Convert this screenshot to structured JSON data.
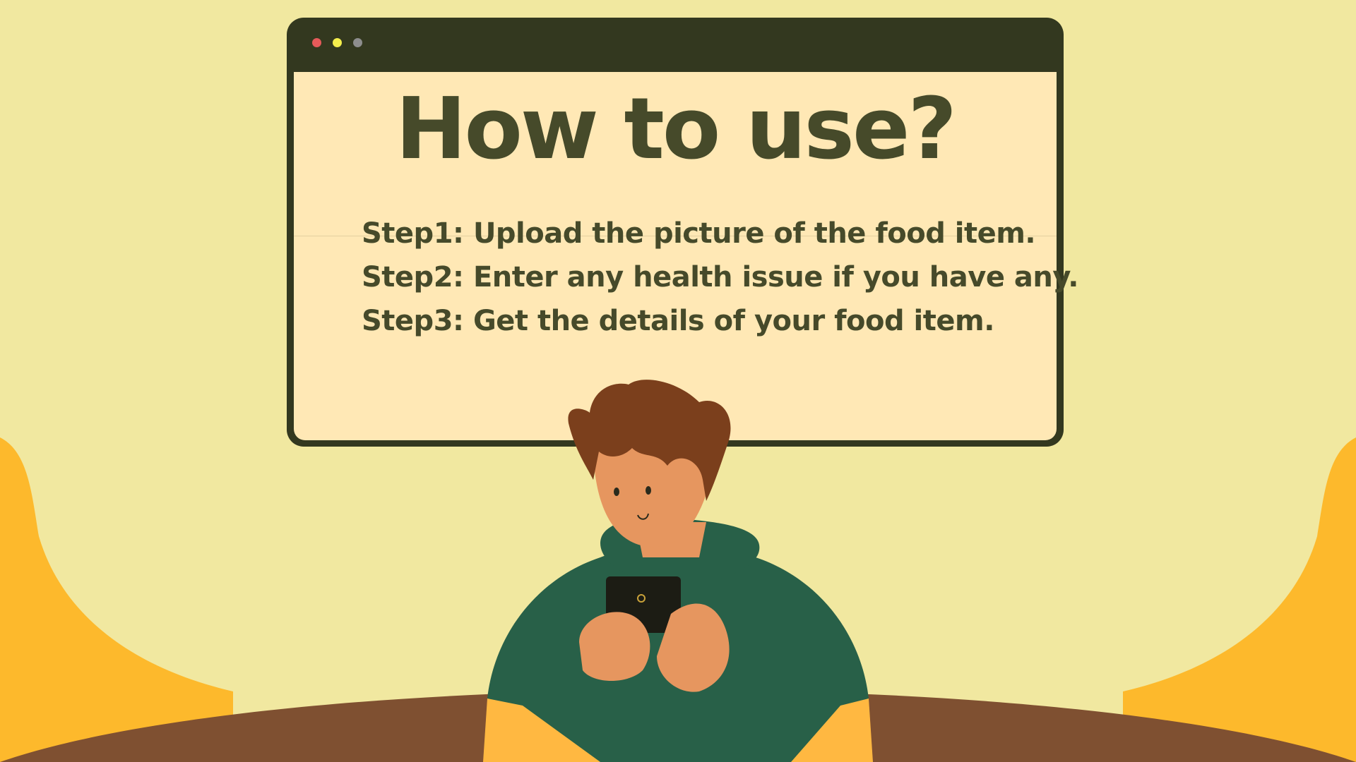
{
  "window": {
    "controls": [
      "close-dot",
      "minimize-dot",
      "maximize-dot"
    ]
  },
  "title": "How to use?",
  "steps": [
    "Step1: Upload the picture of the food item.",
    "Step2: Enter any health issue if you have any.",
    "Step3: Get the details of your food item."
  ],
  "colors": {
    "background": "#f1e8a0",
    "window_frame": "#33381f",
    "window_content": "#ffe8b5",
    "text": "#464a2a",
    "hills": "#fdb92c",
    "ground": "#7f5031",
    "hoodie": "#286048",
    "skin": "#e6965f",
    "hair": "#7b3f1c",
    "sleeve": "#ffb841"
  },
  "illustration": "person-with-phone"
}
